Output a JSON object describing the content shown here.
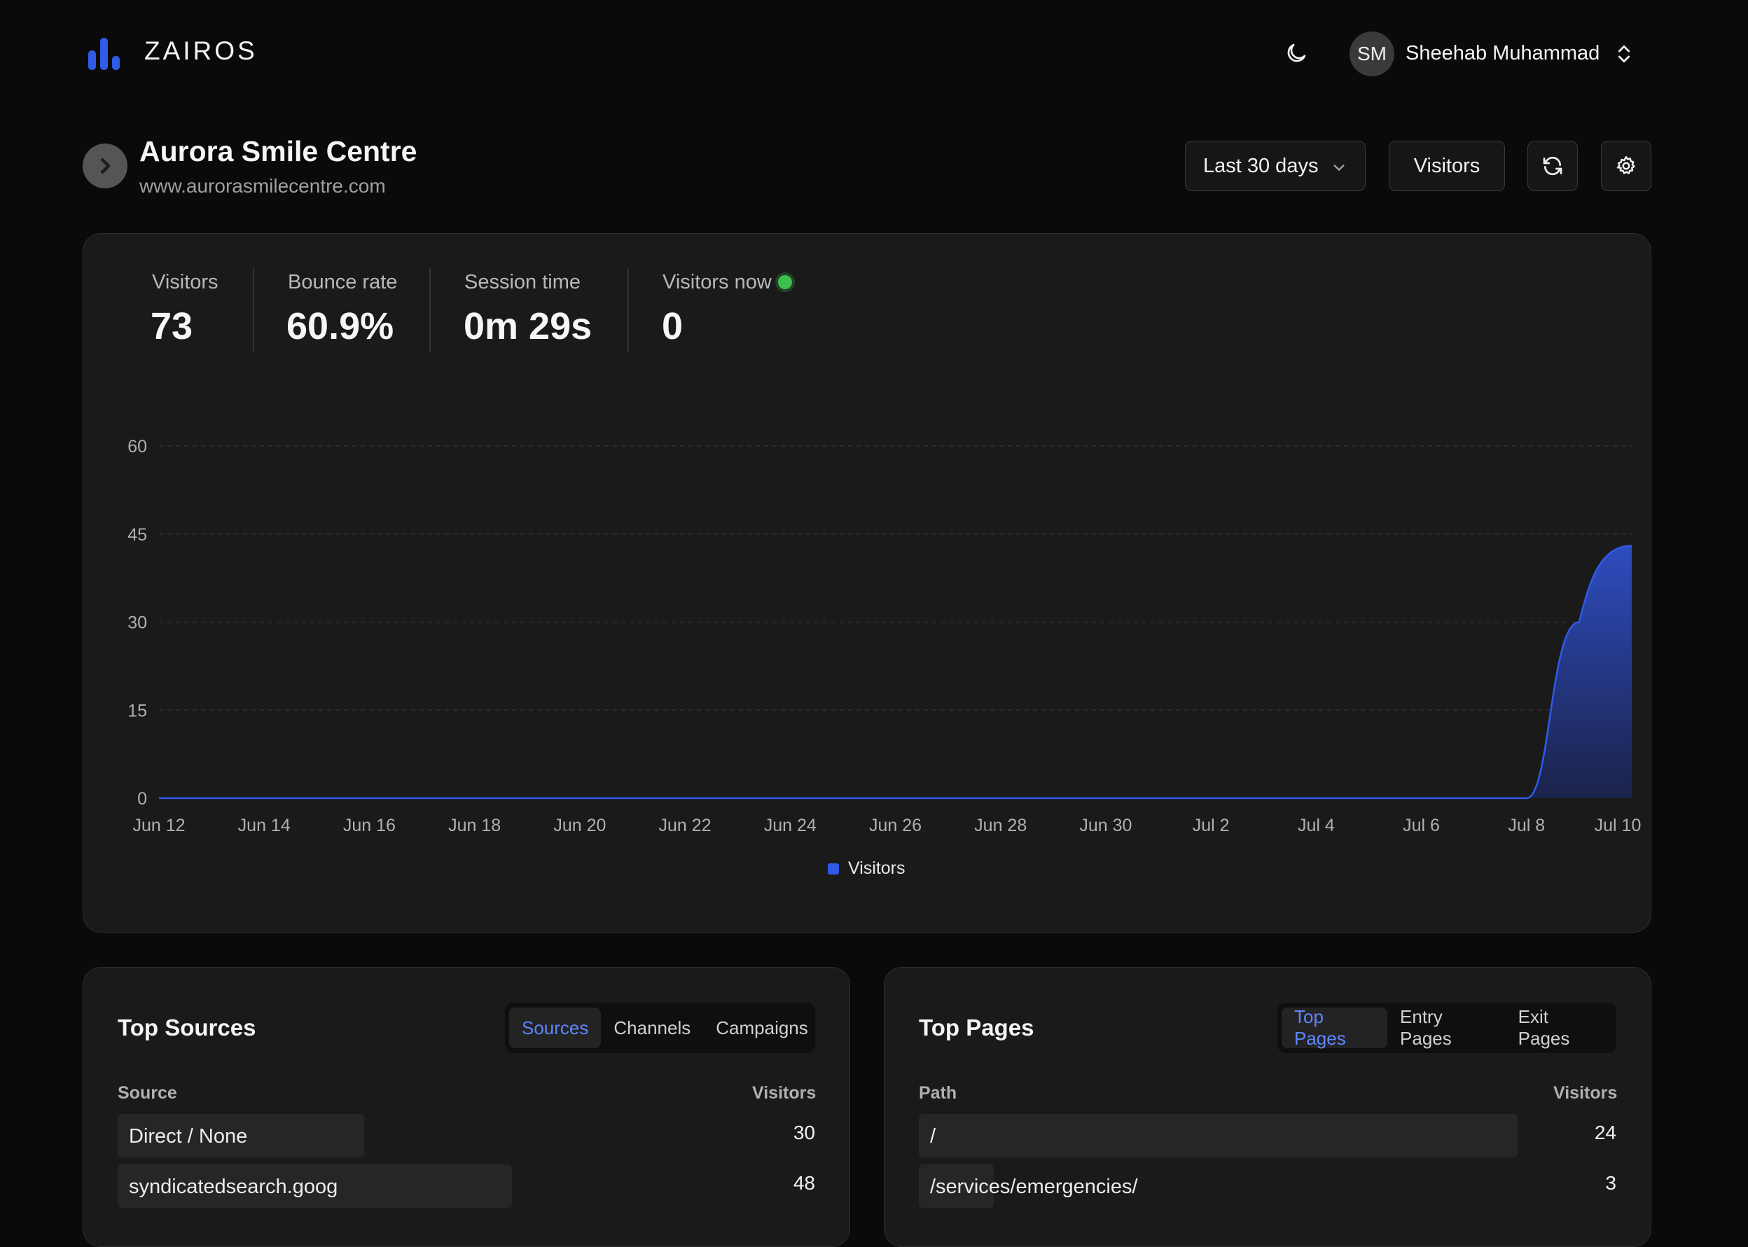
{
  "header": {
    "brand": "ZAIROS",
    "user": {
      "initials": "SM",
      "name": "Sheehab Muhammad"
    }
  },
  "site": {
    "name": "Aurora Smile Centre",
    "url": "www.aurorasmilecentre.com"
  },
  "toolbar": {
    "range_label": "Last 30 days",
    "metric_label": "Visitors"
  },
  "stats": [
    {
      "label": "Visitors",
      "value": "73"
    },
    {
      "label": "Bounce rate",
      "value": "60.9%"
    },
    {
      "label": "Session time",
      "value": "0m 29s"
    },
    {
      "label": "Visitors now",
      "value": "0"
    }
  ],
  "colors": {
    "accent": "#2f5be8",
    "live": "#3fbf4f",
    "tab_active": "#5f86ff"
  },
  "chart_data": {
    "type": "area",
    "x": [
      "Jun 12",
      "Jun 13",
      "Jun 14",
      "Jun 15",
      "Jun 16",
      "Jun 17",
      "Jun 18",
      "Jun 19",
      "Jun 20",
      "Jun 21",
      "Jun 22",
      "Jun 23",
      "Jun 24",
      "Jun 25",
      "Jun 26",
      "Jun 27",
      "Jun 28",
      "Jun 29",
      "Jun 30",
      "Jul 1",
      "Jul 2",
      "Jul 3",
      "Jul 4",
      "Jul 5",
      "Jul 6",
      "Jul 7",
      "Jul 8",
      "Jul 9",
      "Jul 10"
    ],
    "x_tick_labels": [
      "Jun 12",
      "Jun 14",
      "Jun 16",
      "Jun 18",
      "Jun 20",
      "Jun 22",
      "Jun 24",
      "Jun 26",
      "Jun 28",
      "Jun 30",
      "Jul 2",
      "Jul 4",
      "Jul 6",
      "Jul 8",
      "Jul 10"
    ],
    "series": [
      {
        "name": "Visitors",
        "values": [
          0,
          0,
          0,
          0,
          0,
          0,
          0,
          0,
          0,
          0,
          0,
          0,
          0,
          0,
          0,
          0,
          0,
          0,
          0,
          0,
          0,
          0,
          0,
          0,
          0,
          0,
          0,
          30,
          43
        ]
      }
    ],
    "ylim": [
      0,
      60
    ],
    "y_ticks": [
      0,
      15,
      30,
      45,
      60
    ],
    "grid": true,
    "legend": "bottom-center"
  },
  "sources": {
    "title": "Top Sources",
    "tabs": [
      "Sources",
      "Channels",
      "Campaigns"
    ],
    "active_tab": "Sources",
    "columns": [
      "Source",
      "Visitors"
    ],
    "rows": [
      {
        "label": "Direct / None",
        "value": "30",
        "share": 0.625
      },
      {
        "label": "syndicatedsearch.goog",
        "value": "48",
        "share": 1.0
      }
    ]
  },
  "pages": {
    "title": "Top Pages",
    "tabs": [
      "Top Pages",
      "Entry Pages",
      "Exit Pages"
    ],
    "active_tab": "Top Pages",
    "columns": [
      "Path",
      "Visitors"
    ],
    "rows": [
      {
        "label": "/",
        "value": "24",
        "share": 1.0
      },
      {
        "label": "/services/emergencies/",
        "value": "3",
        "share": 0.125
      }
    ]
  }
}
